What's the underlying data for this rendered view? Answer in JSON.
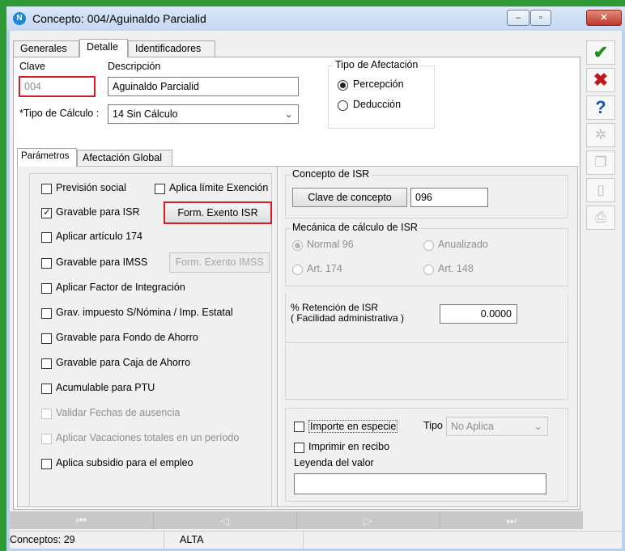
{
  "window": {
    "title": "Concepto: 004/Aguinaldo Parcialid",
    "app_icon": "N",
    "controls": {
      "min": "–",
      "max": "▫",
      "close": "✕"
    }
  },
  "tabs": [
    "Generales",
    "Detalle",
    "Identificadores"
  ],
  "header": {
    "clave_label": "Clave",
    "clave_value": "004",
    "descripcion_label": "Descripción",
    "descripcion_value": "Aguinaldo Parcialid",
    "tipo_calculo_label": "*Tipo de Cálculo :",
    "tipo_calculo_value": "14 Sin Cálculo",
    "tipo_afectacion": {
      "title": "Tipo de Afectación",
      "options": [
        "Percepción",
        "Deducción"
      ],
      "selected": "Percepción"
    }
  },
  "subtabs": [
    "Parámetros",
    "Afectación Global"
  ],
  "parametros": {
    "checkboxes": [
      {
        "label": "Previsión social",
        "checked": false,
        "enabled": true
      },
      {
        "label": "Aplica límite Exención",
        "checked": false,
        "enabled": true
      },
      {
        "label": "Gravable para ISR",
        "checked": true,
        "enabled": true
      },
      {
        "label": "Aplicar artículo 174",
        "checked": false,
        "enabled": true
      },
      {
        "label": "Gravable para IMSS",
        "checked": false,
        "enabled": true
      },
      {
        "label": "Aplicar Factor de Integración",
        "checked": false,
        "enabled": true
      },
      {
        "label": "Grav. impuesto S/Nómina / Imp. Estatal",
        "checked": false,
        "enabled": true
      },
      {
        "label": "Gravable para Fondo de Ahorro",
        "checked": false,
        "enabled": true
      },
      {
        "label": "Gravable para Caja de Ahorro",
        "checked": false,
        "enabled": true
      },
      {
        "label": "Acumulable para PTU",
        "checked": false,
        "enabled": true
      },
      {
        "label": "Validar Fechas de ausencia",
        "checked": false,
        "enabled": false
      },
      {
        "label": "Aplicar Vacaciones totales en un período",
        "checked": false,
        "enabled": false
      },
      {
        "label": "Aplica subsidio para el empleo",
        "checked": false,
        "enabled": true
      }
    ],
    "form_exento_isr": "Form. Exento ISR",
    "form_exento_imss": "Form. Exento IMSS"
  },
  "concepto_isr": {
    "title": "Concepto de ISR",
    "button": "Clave de concepto",
    "value": "096"
  },
  "mecanica": {
    "title": "Mecánica de cálculo de ISR",
    "options": [
      "Normal 96",
      "Anualizado",
      "Art. 174",
      "Art. 148"
    ],
    "selected": "Normal 96"
  },
  "retencion": {
    "label_line1": "% Retención de ISR",
    "label_line2": "( Facilidad administrativa )",
    "value": "0.0000"
  },
  "especie": {
    "importe_label": "Importe en especie",
    "tipo_label": "Tipo",
    "tipo_value": "No Aplica",
    "imprimir_label": "Imprimir en recibo",
    "leyenda_label": "Leyenda del valor",
    "leyenda_value": ""
  },
  "sidebar": [
    {
      "icon": "check-icon",
      "glyph": "✔",
      "color": "#1e8e1e",
      "enabled": true
    },
    {
      "icon": "cancel-icon",
      "glyph": "✖",
      "color": "#c0171b",
      "enabled": true
    },
    {
      "icon": "help-icon",
      "glyph": "?",
      "color": "#1558b0",
      "enabled": true
    },
    {
      "icon": "gear-icon",
      "glyph": "✲",
      "color": "#c0c0c0",
      "enabled": false
    },
    {
      "icon": "copy-icon",
      "glyph": "❐",
      "color": "#c0c0c0",
      "enabled": false
    },
    {
      "icon": "document-icon",
      "glyph": "▯",
      "color": "#c0c0c0",
      "enabled": false
    },
    {
      "icon": "print-icon",
      "glyph": "⎙",
      "color": "#c0c0c0",
      "enabled": false
    }
  ],
  "navigation": [
    "⏮",
    "◁",
    "▷",
    "⏭"
  ],
  "status": {
    "count": "Conceptos: 29",
    "mode": "ALTA"
  }
}
